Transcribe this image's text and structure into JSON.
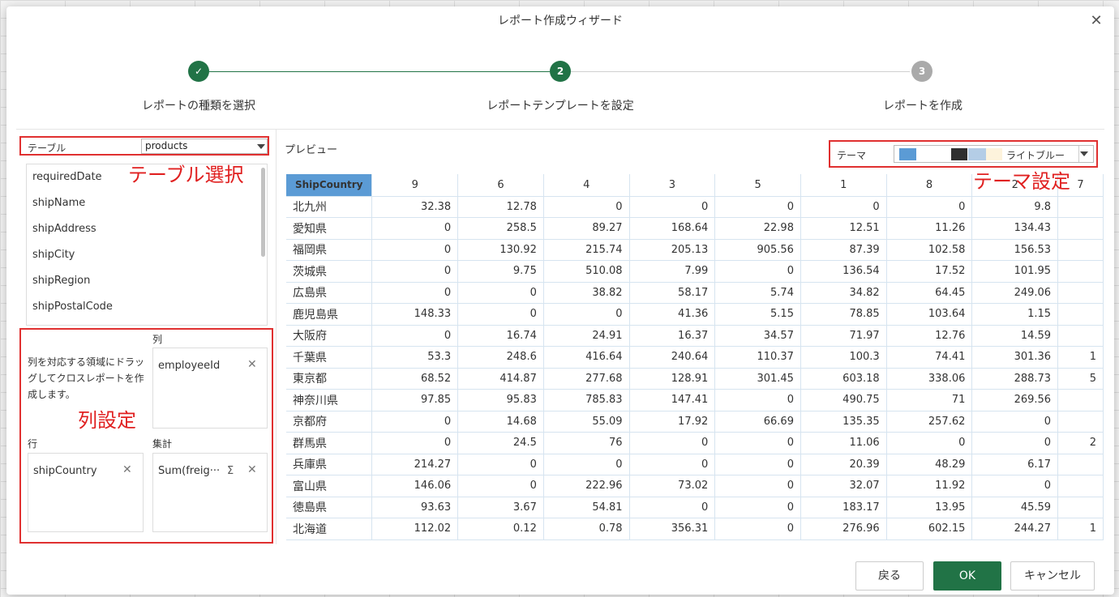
{
  "dialog": {
    "title": "レポート作成ウィザード"
  },
  "steps": [
    {
      "number": "✓",
      "label": "レポートの種類を選択",
      "state": "done"
    },
    {
      "number": "2",
      "label": "レポートテンプレートを設定",
      "state": "current"
    },
    {
      "number": "3",
      "label": "レポートを作成",
      "state": "pending"
    }
  ],
  "colors": {
    "accent": "#217346",
    "pending": "#aaaaaa",
    "annotation": "#e02020",
    "header": "#5b9bd5"
  },
  "table_selector": {
    "label": "テーブル",
    "value": "products"
  },
  "annotations": {
    "table": "テーブル選択",
    "columns": "列設定",
    "theme": "テーマ設定"
  },
  "fields": [
    "requiredDate",
    "shipName",
    "shipAddress",
    "shipCity",
    "shipRegion",
    "shipPostalCode"
  ],
  "layout_area": {
    "help": "列を対応する領域にドラッグしてクロスレポートを作成します。",
    "columns_label": "列",
    "columns_value": "employeeId",
    "rows_label": "行",
    "rows_value": "shipCountry",
    "values_label": "集計",
    "values_value": "Sum(freig···",
    "sigma": "Σ",
    "remove": "✕"
  },
  "preview": {
    "label": "プレビュー",
    "theme_label": "テーマ",
    "theme_name": "ライトブルー",
    "theme_swatches": [
      "#5b9bd5",
      "#ffffff",
      "#ffffff",
      "#2f2f2f",
      "#b4cde6",
      "#fdf3dc"
    ],
    "corner": "ShipCountry",
    "columns": [
      "9",
      "6",
      "4",
      "3",
      "5",
      "1",
      "8",
      "2",
      "7"
    ],
    "rows": [
      {
        "name": "北九州",
        "values": [
          "32.38",
          "12.78",
          "0",
          "0",
          "0",
          "0",
          "0",
          "9.8",
          ""
        ]
      },
      {
        "name": "愛知県",
        "values": [
          "0",
          "258.5",
          "89.27",
          "168.64",
          "22.98",
          "12.51",
          "11.26",
          "134.43",
          ""
        ]
      },
      {
        "name": "福岡県",
        "values": [
          "0",
          "130.92",
          "215.74",
          "205.13",
          "905.56",
          "87.39",
          "102.58",
          "156.53",
          ""
        ]
      },
      {
        "name": "茨城県",
        "values": [
          "0",
          "9.75",
          "510.08",
          "7.99",
          "0",
          "136.54",
          "17.52",
          "101.95",
          ""
        ]
      },
      {
        "name": "広島県",
        "values": [
          "0",
          "0",
          "38.82",
          "58.17",
          "5.74",
          "34.82",
          "64.45",
          "249.06",
          ""
        ]
      },
      {
        "name": "鹿児島県",
        "values": [
          "148.33",
          "0",
          "0",
          "41.36",
          "5.15",
          "78.85",
          "103.64",
          "1.15",
          ""
        ]
      },
      {
        "name": "大阪府",
        "values": [
          "0",
          "16.74",
          "24.91",
          "16.37",
          "34.57",
          "71.97",
          "12.76",
          "14.59",
          ""
        ]
      },
      {
        "name": "千葉県",
        "values": [
          "53.3",
          "248.6",
          "416.64",
          "240.64",
          "110.37",
          "100.3",
          "74.41",
          "301.36",
          "1"
        ]
      },
      {
        "name": "東京都",
        "values": [
          "68.52",
          "414.87",
          "277.68",
          "128.91",
          "301.45",
          "603.18",
          "338.06",
          "288.73",
          "5"
        ]
      },
      {
        "name": "神奈川県",
        "values": [
          "97.85",
          "95.83",
          "785.83",
          "147.41",
          "0",
          "490.75",
          "71",
          "269.56",
          ""
        ]
      },
      {
        "name": "京都府",
        "values": [
          "0",
          "14.68",
          "55.09",
          "17.92",
          "66.69",
          "135.35",
          "257.62",
          "0",
          ""
        ]
      },
      {
        "name": "群馬県",
        "values": [
          "0",
          "24.5",
          "76",
          "0",
          "0",
          "11.06",
          "0",
          "0",
          "2"
        ]
      },
      {
        "name": "兵庫県",
        "values": [
          "214.27",
          "0",
          "0",
          "0",
          "0",
          "20.39",
          "48.29",
          "6.17",
          ""
        ]
      },
      {
        "name": "富山県",
        "values": [
          "146.06",
          "0",
          "222.96",
          "73.02",
          "0",
          "32.07",
          "11.92",
          "0",
          ""
        ]
      },
      {
        "name": "徳島県",
        "values": [
          "93.63",
          "3.67",
          "54.81",
          "0",
          "0",
          "183.17",
          "13.95",
          "45.59",
          ""
        ]
      },
      {
        "name": "北海道",
        "values": [
          "112.02",
          "0.12",
          "0.78",
          "356.31",
          "0",
          "276.96",
          "602.15",
          "244.27",
          "1"
        ]
      }
    ]
  },
  "footer": {
    "back": "戻る",
    "ok": "OK",
    "cancel": "キャンセル"
  }
}
